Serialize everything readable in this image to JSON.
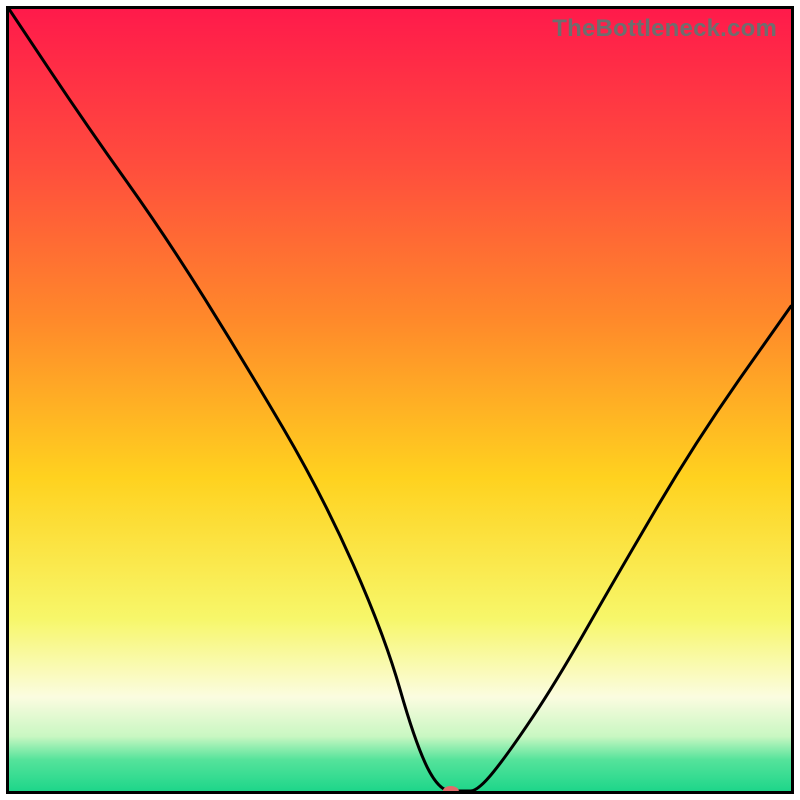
{
  "watermark": "TheBottleneck.com",
  "chart_data": {
    "type": "line",
    "title": "",
    "xlabel": "",
    "ylabel": "",
    "xlim": [
      0,
      100
    ],
    "ylim": [
      0,
      100
    ],
    "grid": false,
    "legend": null,
    "background_gradient": {
      "stops": [
        {
          "offset": 0.0,
          "color": "#ff1a4b"
        },
        {
          "offset": 0.2,
          "color": "#ff4d3d"
        },
        {
          "offset": 0.4,
          "color": "#ff8a2a"
        },
        {
          "offset": 0.6,
          "color": "#ffd21f"
        },
        {
          "offset": 0.78,
          "color": "#f7f76a"
        },
        {
          "offset": 0.88,
          "color": "#fbfce0"
        },
        {
          "offset": 0.93,
          "color": "#c9f7c2"
        },
        {
          "offset": 0.96,
          "color": "#55e39b"
        },
        {
          "offset": 1.0,
          "color": "#1ed68a"
        }
      ]
    },
    "series": [
      {
        "name": "bottleneck-curve",
        "x": [
          0,
          10,
          20,
          30,
          40,
          48,
          52,
          55,
          58,
          60,
          64,
          70,
          78,
          88,
          100
        ],
        "values": [
          100,
          85,
          71,
          55,
          38,
          20,
          6,
          0,
          0,
          0,
          5,
          14,
          28,
          45,
          62
        ]
      }
    ],
    "marker": {
      "name": "bottleneck-point",
      "x": 56.5,
      "y": 0,
      "color": "#e26b6b",
      "rx": 8,
      "ry": 5
    }
  }
}
